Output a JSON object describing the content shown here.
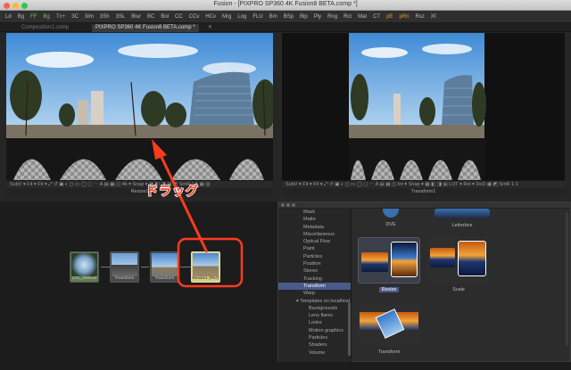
{
  "window": {
    "title": "Fusion - [PIXPRO SP360 4K Fusion8 BETA.comp *]",
    "traffic_lights": [
      "#fc5f57",
      "#fdbc2e",
      "#34c749"
    ]
  },
  "toolbar": {
    "items": [
      "Ld",
      "Bg",
      "FF",
      "Bg",
      "Tn+",
      "3C",
      "3Im",
      "3Sh",
      "3SL",
      "Blur",
      "BC",
      "Bol",
      "CC",
      "CCv",
      "HCv",
      "Mrg",
      "Log",
      "FLU",
      "Bm",
      "BSp",
      "Blp",
      "Ply",
      "Rng",
      "Rct",
      "Mat",
      "CT",
      "pE",
      "pRn",
      "Rsz",
      "Xf"
    ],
    "accent_items_color": "#d4a23a"
  },
  "tabs": [
    {
      "label": "Composition1.comp"
    },
    {
      "label": "PIXPRO SP360 4K Fusion8 BETA.comp *",
      "active": true
    }
  ],
  "viewers": {
    "left": {
      "controls": "SubV ▾  Fit ▾  Fit ▾  ⤢  ↺  ▣  ◐  ◻  ▭  ◯  ▢  ⋯  A  ▤  ▦  ◫  4k ▾  Snap ▾  ▦  ◧  ◨  ▤  ◩  SmR  1:1  ▦  ▥",
      "label": "Resize1"
    },
    "right": {
      "controls": "SubV ▾  Fit ▾  Fit ▾  ⤢  ↺  ▣  ◐  ◻  ▭  ◯  ▢  ⋯  A  ▤  ▦  ◫  Int ▾  Snap ▾  ▦  ◧  ◨  ▤  LUT ▾  Roi ▾  DoD  ▦  ◩  SmR  1:1",
      "label": "Transform1"
    }
  },
  "flow": {
    "nodes": [
      {
        "label": "LTC_0005.M"
      },
      {
        "label": "Transform"
      },
      {
        "label": "Transform"
      },
      {
        "label": "Resize1 (Rsz)"
      }
    ]
  },
  "annotation": {
    "drag_label": "ドラッグ",
    "color": "#ff3b1f"
  },
  "library": {
    "tree_items": [
      {
        "label": "Mask"
      },
      {
        "label": "Matte"
      },
      {
        "label": "Metadata"
      },
      {
        "label": "Miscellaneous"
      },
      {
        "label": "Optical Flow"
      },
      {
        "label": "Paint"
      },
      {
        "label": "Particles"
      },
      {
        "label": "Position"
      },
      {
        "label": "Stereo"
      },
      {
        "label": "Tracking"
      },
      {
        "label": "Transform",
        "selected": true
      },
      {
        "label": "Warp"
      },
      {
        "label": "▾ Templates on localhost",
        "indent": 1
      },
      {
        "label": "Backgrounds",
        "indent": 2
      },
      {
        "label": "Lens flares",
        "indent": 2
      },
      {
        "label": "Looks",
        "indent": 2
      },
      {
        "label": "Motion graphics",
        "indent": 2
      },
      {
        "label": "Particles",
        "indent": 2
      },
      {
        "label": "Shaders",
        "indent": 2
      },
      {
        "label": "Volume",
        "indent": 2
      }
    ],
    "cards": [
      {
        "label": "DVE"
      },
      {
        "label": "Letterbox"
      },
      {
        "label": "Resize",
        "selected": true
      },
      {
        "label": "Scale"
      },
      {
        "label": "Transform"
      }
    ]
  }
}
